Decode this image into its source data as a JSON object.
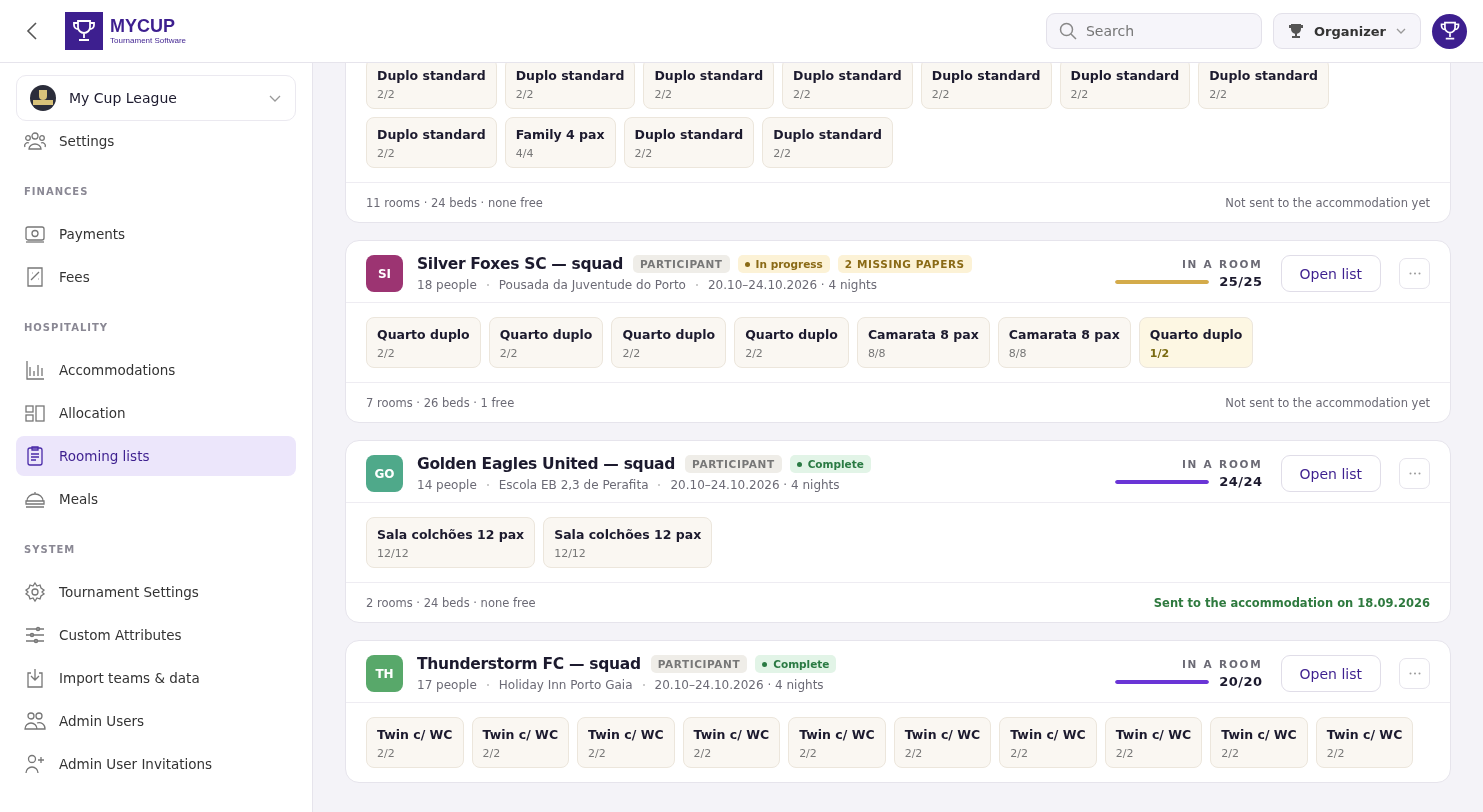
{
  "header": {
    "logo": {
      "title": "MYCUP",
      "subtitle": "Tournament Software"
    },
    "search": {
      "placeholder": "Search"
    },
    "role": {
      "label": "Organizer"
    }
  },
  "sidebar": {
    "organization": {
      "name": "My Cup League"
    },
    "items": [
      {
        "label": "Settings",
        "selected": false
      }
    ],
    "sections": [
      {
        "title": "FINANCES",
        "items": [
          {
            "label": "Payments",
            "selected": false
          },
          {
            "label": "Fees",
            "selected": false
          }
        ]
      },
      {
        "title": "HOSPITALITY",
        "items": [
          {
            "label": "Accommodations",
            "selected": false
          },
          {
            "label": "Allocation",
            "selected": false
          },
          {
            "label": "Rooming lists",
            "selected": true
          },
          {
            "label": "Meals",
            "selected": false
          }
        ]
      },
      {
        "title": "SYSTEM",
        "items": [
          {
            "label": "Tournament Settings",
            "selected": false
          },
          {
            "label": "Custom Attributes",
            "selected": false
          },
          {
            "label": "Import teams & data",
            "selected": false
          },
          {
            "label": "Admin Users",
            "selected": false
          },
          {
            "label": "Admin User Invitations",
            "selected": false
          }
        ]
      }
    ]
  },
  "cards": [
    {
      "rooms": [
        {
          "name": "Duplo standard",
          "count": "2/2",
          "partial": false
        },
        {
          "name": "Duplo standard",
          "count": "2/2",
          "partial": false
        },
        {
          "name": "Duplo standard",
          "count": "2/2",
          "partial": false
        },
        {
          "name": "Duplo standard",
          "count": "2/2",
          "partial": false
        },
        {
          "name": "Duplo standard",
          "count": "2/2",
          "partial": false
        },
        {
          "name": "Duplo standard",
          "count": "2/2",
          "partial": false
        },
        {
          "name": "Duplo standard",
          "count": "2/2",
          "partial": false
        },
        {
          "name": "Duplo standard",
          "count": "2/2",
          "partial": false
        },
        {
          "name": "Family 4 pax",
          "count": "4/4",
          "partial": false
        },
        {
          "name": "Duplo standard",
          "count": "2/2",
          "partial": false
        },
        {
          "name": "Duplo standard",
          "count": "2/2",
          "partial": false
        }
      ],
      "summary": "11 rooms · 24 beds · none free",
      "send_status": "Not sent to the accommodation yet",
      "sent": false
    },
    {
      "initials": "SI",
      "color": "#9c3472",
      "name": "Silver Foxes SC — squad",
      "role": "PARTICIPANT",
      "status": {
        "kind": "in_progress",
        "label": "In progress"
      },
      "warning": "2 MISSING PAPERS",
      "people": "18 people",
      "place": "Pousada da Juventude do Porto",
      "dates": "20.10–24.10.2026 · 4 nights",
      "progress_label": "IN A ROOM",
      "level": 1,
      "progress": "25/25",
      "button": "Open list",
      "rooms": [
        {
          "name": "Quarto duplo",
          "count": "2/2",
          "partial": false
        },
        {
          "name": "Quarto duplo",
          "count": "2/2",
          "partial": false
        },
        {
          "name": "Quarto duplo",
          "count": "2/2",
          "partial": false
        },
        {
          "name": "Quarto duplo",
          "count": "2/2",
          "partial": false
        },
        {
          "name": "Camarata 8 pax",
          "count": "8/8",
          "partial": false
        },
        {
          "name": "Camarata 8 pax",
          "count": "8/8",
          "partial": false
        },
        {
          "name": "Quarto duplo",
          "count": "1/2",
          "partial": true
        }
      ],
      "summary": "7 rooms · 26 beds · 1 free",
      "send_status": "Not sent to the accommodation yet",
      "sent": false
    },
    {
      "initials": "GO",
      "color": "#4fa98a",
      "name": "Golden Eagles United — squad",
      "role": "PARTICIPANT",
      "status": {
        "kind": "complete",
        "label": "Complete"
      },
      "people": "14 people",
      "place": "Escola EB 2,3 de Perafita",
      "dates": "20.10–24.10.2026 · 4 nights",
      "progress_label": "IN A ROOM",
      "level": 1,
      "progress": "24/24",
      "button": "Open list",
      "rooms": [
        {
          "name": "Sala colchões 12 pax",
          "count": "12/12",
          "partial": false
        },
        {
          "name": "Sala colchões 12 pax",
          "count": "12/12",
          "partial": false
        }
      ],
      "summary": "2 rooms · 24 beds · none free",
      "send_status": "Sent to the accommodation on 18.09.2026",
      "sent": true
    },
    {
      "initials": "TH",
      "color": "#58a86a",
      "name": "Thunderstorm FC — squad",
      "role": "PARTICIPANT",
      "status": {
        "kind": "complete",
        "label": "Complete"
      },
      "people": "17 people",
      "place": "Holiday Inn Porto Gaia",
      "dates": "20.10–24.10.2026 · 4 nights",
      "progress_label": "IN A ROOM",
      "level": 1,
      "progress": "20/20",
      "button": "Open list",
      "rooms": [
        {
          "name": "Twin c/ WC",
          "count": "2/2",
          "partial": false
        },
        {
          "name": "Twin c/ WC",
          "count": "2/2",
          "partial": false
        },
        {
          "name": "Twin c/ WC",
          "count": "2/2",
          "partial": false
        },
        {
          "name": "Twin c/ WC",
          "count": "2/2",
          "partial": false
        },
        {
          "name": "Twin c/ WC",
          "count": "2/2",
          "partial": false
        },
        {
          "name": "Twin c/ WC",
          "count": "2/2",
          "partial": false
        },
        {
          "name": "Twin c/ WC",
          "count": "2/2",
          "partial": false
        },
        {
          "name": "Twin c/ WC",
          "count": "2/2",
          "partial": false
        },
        {
          "name": "Twin c/ WC",
          "count": "2/2",
          "partial": false
        },
        {
          "name": "Twin c/ WC",
          "count": "2/2",
          "partial": false
        }
      ]
    }
  ]
}
